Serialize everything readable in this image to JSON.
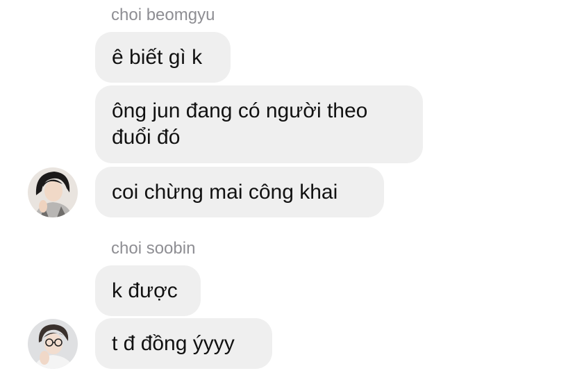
{
  "groups": [
    {
      "sender": "choi beomgyu",
      "avatar_icon": "profile-photo-avatar",
      "messages": [
        "ê biết gì k",
        "ông jun đang có người theo đuổi đó",
        "coi chừng mai công khai"
      ]
    },
    {
      "sender": "choi soobin",
      "avatar_icon": "profile-photo-avatar",
      "messages": [
        "k được",
        "t đ đồng ýyyy"
      ]
    }
  ],
  "colors": {
    "bubble_bg": "#efefef",
    "sender_text": "#8e8e93",
    "message_text": "#111111",
    "background": "#ffffff"
  }
}
